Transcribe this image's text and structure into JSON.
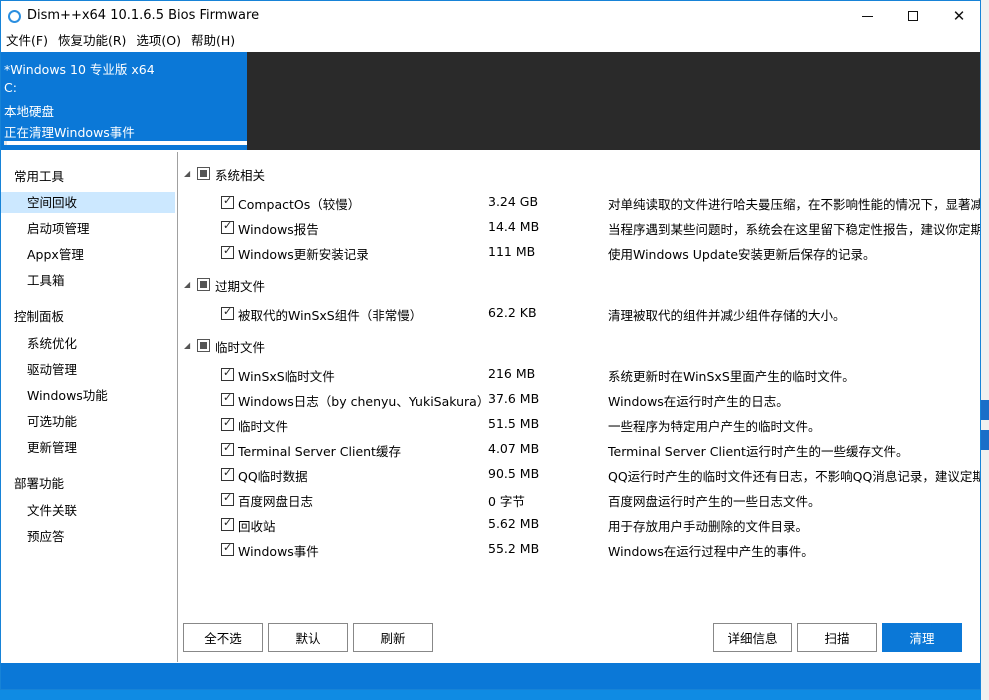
{
  "window": {
    "title": "Dism++x64 10.1.6.5 Bios Firmware"
  },
  "menu": [
    "文件(F)",
    "恢复功能(R)",
    "选项(O)",
    "帮助(H)"
  ],
  "header": {
    "system": "*Windows 10 专业版 x64",
    "drive": "C:",
    "disk": "本地硬盘",
    "status": "正在清理Windows事件",
    "progress": 1.0
  },
  "sidebar": {
    "groups": [
      {
        "label": "常用工具",
        "items": [
          "空间回收",
          "启动项管理",
          "Appx管理",
          "工具箱"
        ]
      },
      {
        "label": "控制面板",
        "items": [
          "系统优化",
          "驱动管理",
          "Windows功能",
          "可选功能",
          "更新管理"
        ]
      },
      {
        "label": "部署功能",
        "items": [
          "文件关联",
          "预应答"
        ]
      }
    ],
    "selected": "空间回收"
  },
  "sections": [
    {
      "label": "系统相关",
      "rows": [
        {
          "name": "CompactOs（较慢）",
          "size": "3.24 GB",
          "desc": "对单纯读取的文件进行哈夫曼压缩，在不影响性能的情况下，显著减少"
        },
        {
          "name": "Windows报告",
          "size": "14.4 MB",
          "desc": "当程序遇到某些问题时，系统会在这里留下稳定性报告，建议你定期清"
        },
        {
          "name": "Windows更新安装记录",
          "size": "111 MB",
          "desc": "使用Windows Update安装更新后保存的记录。"
        }
      ]
    },
    {
      "label": "过期文件",
      "rows": [
        {
          "name": "被取代的WinSxS组件（非常慢）",
          "size": "62.2 KB",
          "desc": "清理被取代的组件并减少组件存储的大小。"
        }
      ]
    },
    {
      "label": "临时文件",
      "rows": [
        {
          "name": "WinSxS临时文件",
          "size": "216 MB",
          "desc": "系统更新时在WinSxS里面产生的临时文件。"
        },
        {
          "name": "Windows日志（by chenyu、YukiSakura）",
          "size": "37.6 MB",
          "desc": "Windows在运行时产生的日志。"
        },
        {
          "name": "临时文件",
          "size": "51.5 MB",
          "desc": "一些程序为特定用户产生的临时文件。"
        },
        {
          "name": "Terminal Server Client缓存",
          "size": "4.07 MB",
          "desc": "Terminal Server Client运行时产生的一些缓存文件。"
        },
        {
          "name": "QQ临时数据",
          "size": "90.5 MB",
          "desc": "QQ运行时产生的临时文件还有日志，不影响QQ消息记录，建议定期"
        },
        {
          "name": "百度网盘日志",
          "size": "0 字节",
          "desc": "百度网盘运行时产生的一些日志文件。"
        },
        {
          "name": "回收站",
          "size": "5.62 MB",
          "desc": "用于存放用户手动删除的文件目录。"
        },
        {
          "name": "Windows事件",
          "size": "55.2 MB",
          "desc": "Windows在运行过程中产生的事件。"
        }
      ]
    }
  ],
  "buttons": {
    "select_none": "全不选",
    "default": "默认",
    "refresh": "刷新",
    "details": "详细信息",
    "scan": "扫描",
    "clean": "清理"
  },
  "colors": {
    "accent": "#0b78d7",
    "selected_bg": "#cce8ff",
    "header_dark": "#2a2a2a"
  }
}
